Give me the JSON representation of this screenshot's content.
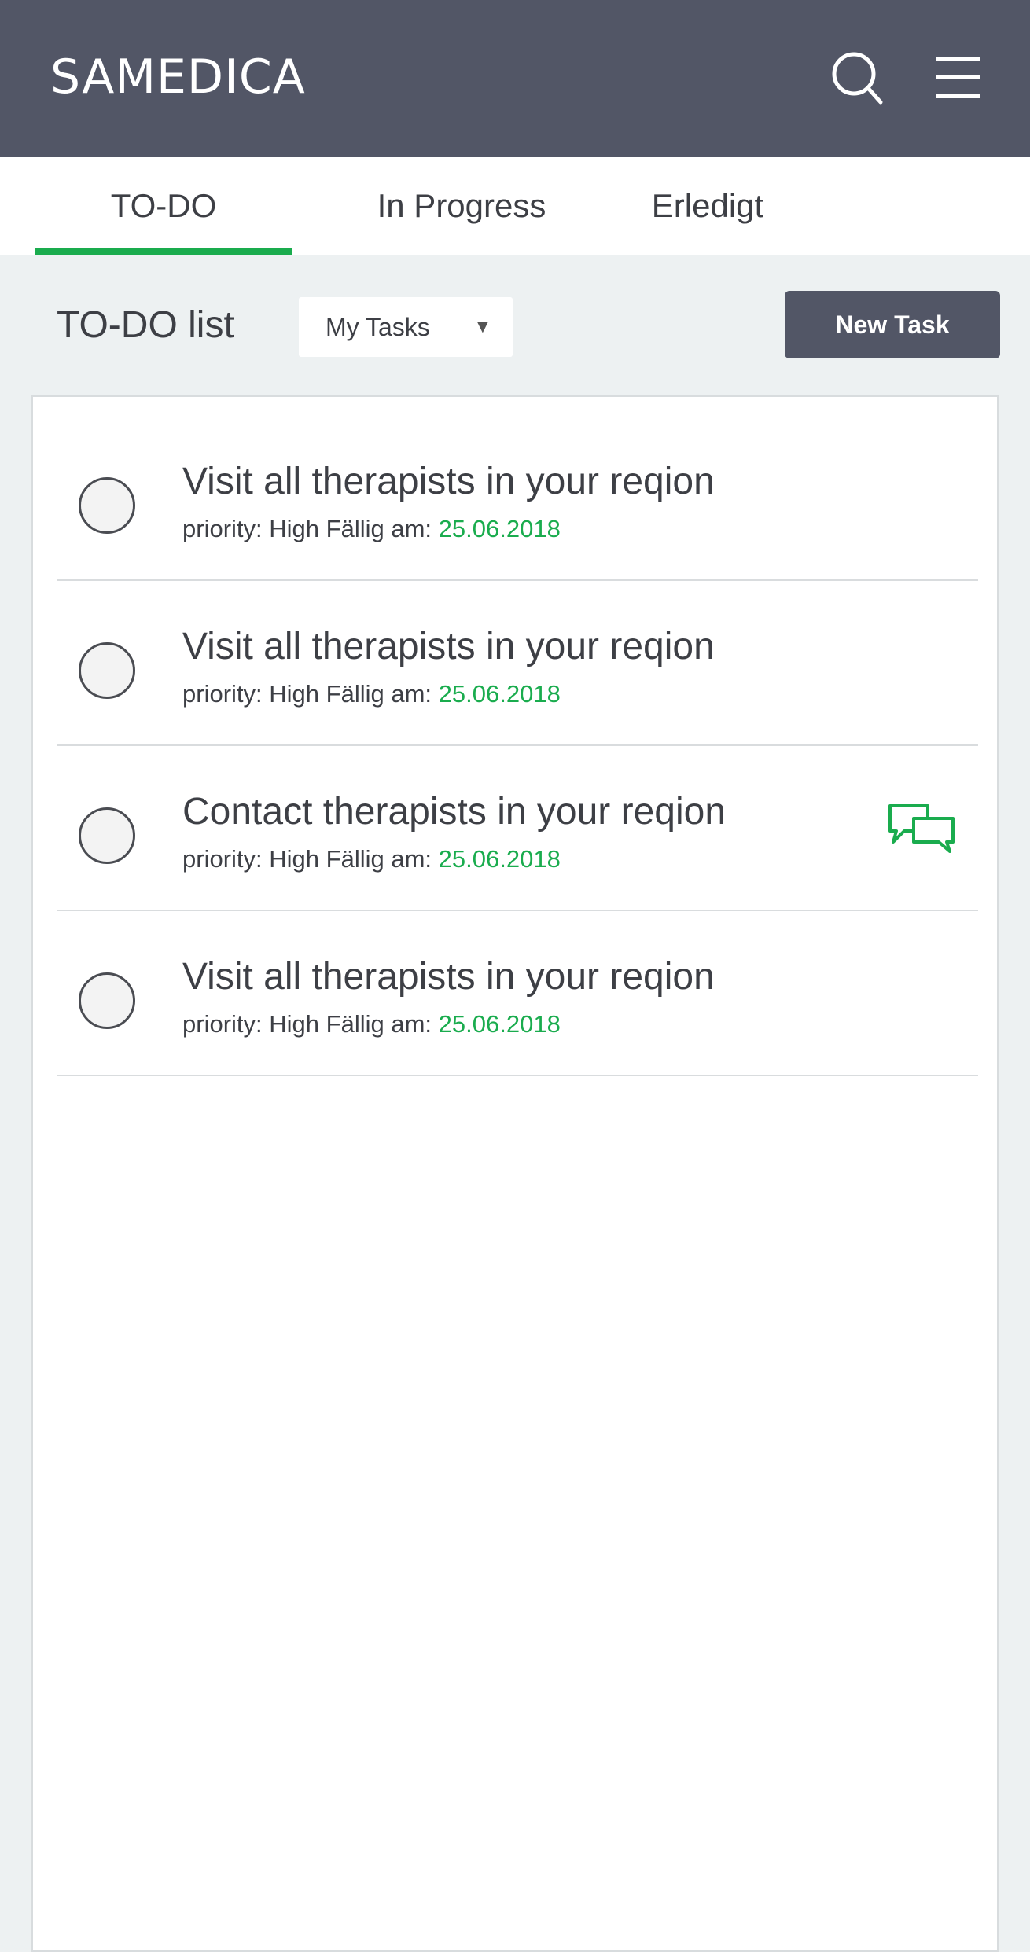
{
  "header": {
    "logo": "SAMEDICA",
    "search_icon": "search-icon",
    "menu_icon": "hamburger-menu-icon",
    "background": "#525666"
  },
  "tabs": [
    {
      "label": "TO-DO",
      "active": true
    },
    {
      "label": "In Progress",
      "active": false
    },
    {
      "label": "Erledigt",
      "active": false
    }
  ],
  "toolbar": {
    "title": "TO-DO list",
    "filter_value": "My Tasks",
    "new_task_label": "New Task"
  },
  "tasks": [
    {
      "title": "Visit all therapists in your reqion",
      "priority_label": "priority:",
      "priority": "High",
      "due_label": "Fällig am:",
      "due_date": "25.06.2018",
      "has_comments": false
    },
    {
      "title": "Visit all therapists in your reqion",
      "priority_label": "priority:",
      "priority": "High",
      "due_label": "Fällig am:",
      "due_date": "25.06.2018",
      "has_comments": false
    },
    {
      "title": "Contact therapists in your reqion",
      "priority_label": "priority:",
      "priority": "High",
      "due_label": "Fällig am:",
      "due_date": "25.06.2018",
      "has_comments": true,
      "comment_icon": "chat-bubbles-icon"
    },
    {
      "title": "Visit all therapists in your reqion",
      "priority_label": "priority:",
      "priority": "High",
      "due_label": "Fällig am:",
      "due_date": "25.06.2018",
      "has_comments": false
    }
  ],
  "colors": {
    "accent": "#1aac4e",
    "header": "#525666",
    "page_background": "#edf1f2",
    "text": "#3d3f45"
  }
}
